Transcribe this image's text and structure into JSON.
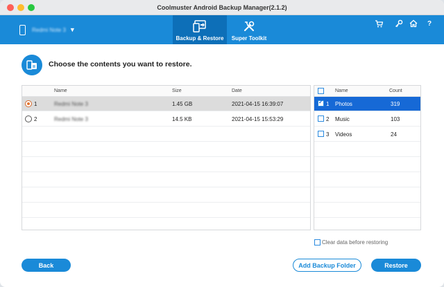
{
  "window": {
    "title": "Coolmuster Android Backup Manager(2.1.2)"
  },
  "header": {
    "device_name": "Redmi Note 3",
    "tabs": [
      {
        "label": "Backup & Restore",
        "icon": "backup-restore-icon",
        "active": true
      },
      {
        "label": "Super Toolkit",
        "icon": "toolkit-icon",
        "active": false
      }
    ],
    "icons": [
      "cart-icon",
      "key-icon",
      "home-icon",
      "help-icon"
    ],
    "help_glyph": "?"
  },
  "prompt": {
    "text": "Choose the contents you want to restore."
  },
  "backups": {
    "columns": {
      "name": "Name",
      "size": "Size",
      "date": "Date"
    },
    "rows": [
      {
        "index": "1",
        "name": "Redmi Note 3",
        "size": "1.45 GB",
        "date": "2021-04-15 16:39:07",
        "selected": true
      },
      {
        "index": "2",
        "name": "Redmi Note 3",
        "size": "14.5 KB",
        "date": "2021-04-15 15:53:29",
        "selected": false
      }
    ]
  },
  "contents": {
    "columns": {
      "name": "Name",
      "count": "Count"
    },
    "rows": [
      {
        "index": "1",
        "name": "Photos",
        "count": "319",
        "checked": true
      },
      {
        "index": "2",
        "name": "Music",
        "count": "103",
        "checked": false
      },
      {
        "index": "3",
        "name": "Videos",
        "count": "24",
        "checked": false
      }
    ]
  },
  "footer": {
    "clear_label": "Clear data before restoring",
    "back_label": "Back",
    "add_folder_label": "Add Backup Folder",
    "restore_label": "Restore"
  },
  "colors": {
    "accent": "#1a8ad8",
    "selection": "#1669d6",
    "radio": "#e5752f"
  }
}
